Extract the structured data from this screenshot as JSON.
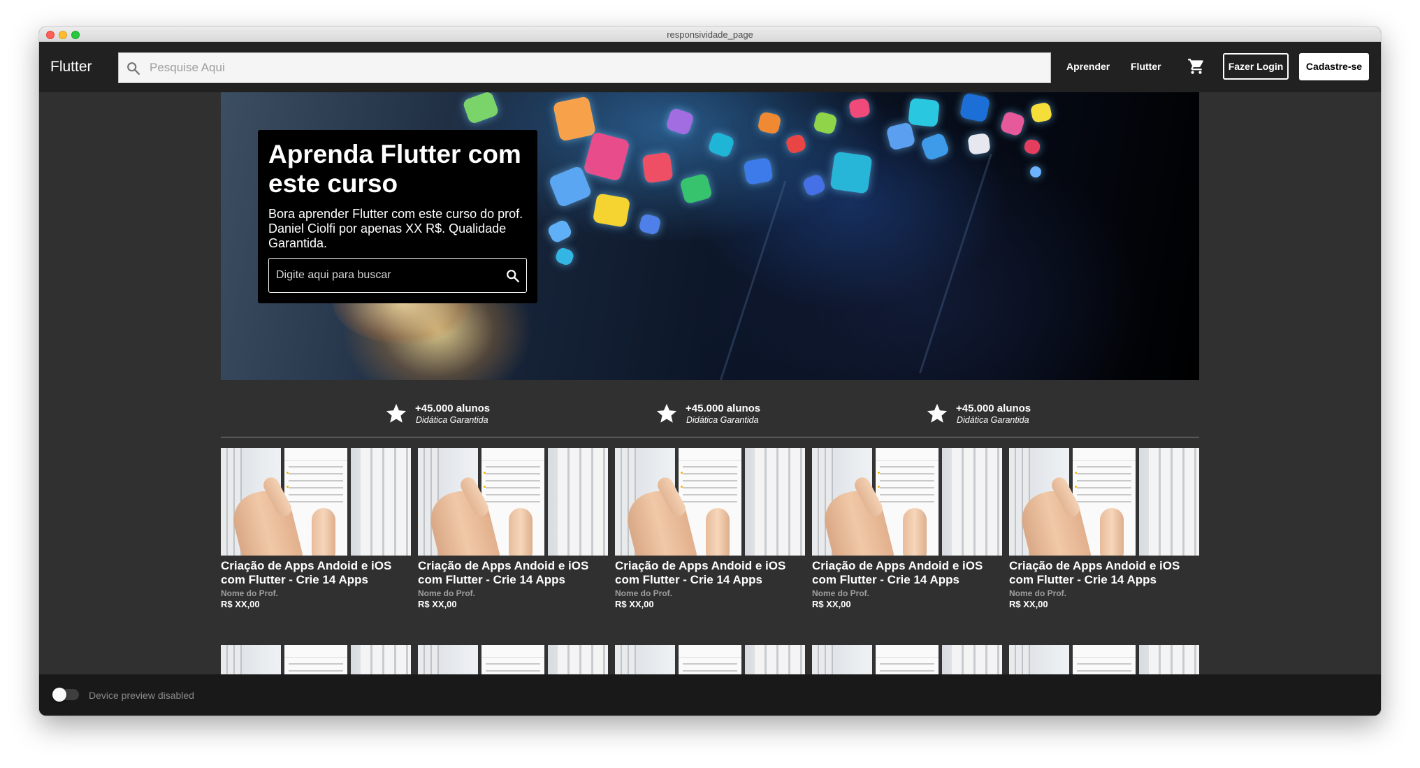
{
  "window": {
    "title": "responsividade_page"
  },
  "appbar": {
    "brand": "Flutter",
    "search_placeholder": "Pesquise Aqui",
    "nav": [
      "Aprender",
      "Flutter"
    ],
    "cart_icon": "shopping-cart-icon",
    "login_label": "Fazer Login",
    "signup_label": "Cadastre-se"
  },
  "hero": {
    "title": "Aprenda Flutter com este curso",
    "description": "Bora aprender Flutter com este curso do prof. Daniel Ciolfi por apenas XX R$. Qualidade Garantida.",
    "search_placeholder": "Digite aqui para buscar"
  },
  "stats": [
    {
      "count": "+45.000 alunos",
      "subtitle": "Didática Garantida",
      "icon": "star-icon"
    },
    {
      "count": "+45.000 alunos",
      "subtitle": "Didática Garantida",
      "icon": "star-icon"
    },
    {
      "count": "+45.000 alunos",
      "subtitle": "Didática Garantida",
      "icon": "star-icon"
    }
  ],
  "courses": [
    {
      "title": "Criação de Apps Andoid e iOS com Flutter - Crie 14 Apps",
      "prof": "Nome do Prof.",
      "price": "R$ XX,00"
    },
    {
      "title": "Criação de Apps Andoid e iOS com Flutter - Crie 14 Apps",
      "prof": "Nome do Prof.",
      "price": "R$ XX,00"
    },
    {
      "title": "Criação de Apps Andoid e iOS com Flutter - Crie 14 Apps",
      "prof": "Nome do Prof.",
      "price": "R$ XX,00"
    },
    {
      "title": "Criação de Apps Andoid e iOS com Flutter - Crie 14 Apps",
      "prof": "Nome do Prof.",
      "price": "R$ XX,00"
    },
    {
      "title": "Criação de Apps Andoid e iOS com Flutter - Crie 14 Apps",
      "prof": "Nome do Prof.",
      "price": "R$ XX,00"
    }
  ],
  "footer": {
    "toggle_label": "Device preview disabled",
    "toggle_on": false
  },
  "colors": {
    "appbar": "#212121",
    "background": "#303030",
    "card": "#000000",
    "footer": "#191919"
  }
}
